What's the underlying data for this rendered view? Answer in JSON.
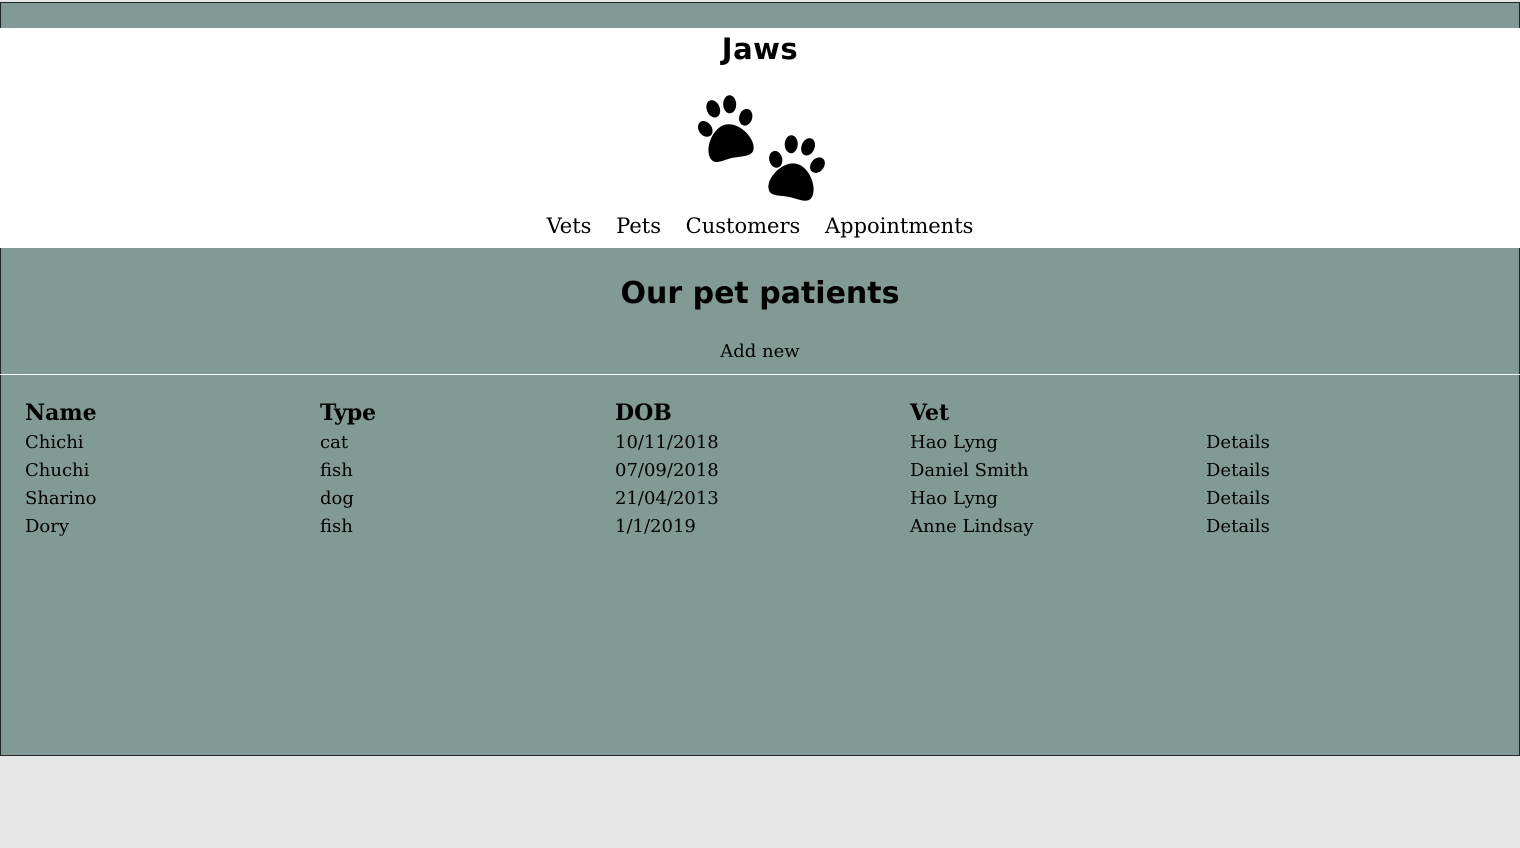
{
  "brand": {
    "title": "Jaws",
    "logo_icon": "paw-prints-icon"
  },
  "nav": {
    "items": [
      {
        "label": "Vets"
      },
      {
        "label": "Pets"
      },
      {
        "label": "Customers"
      },
      {
        "label": "Appointments"
      }
    ]
  },
  "main": {
    "title": "Our pet patients",
    "add_new_label": "Add new"
  },
  "table": {
    "headers": [
      "Name",
      "Type",
      "DOB",
      "Vet"
    ],
    "rows": [
      {
        "name": "Chichi",
        "type": "cat",
        "dob": "10/11/2018",
        "vet": "Hao Lyng",
        "action": "Details"
      },
      {
        "name": "Chuchi",
        "type": "fish",
        "dob": "07/09/2018",
        "vet": "Daniel Smith",
        "action": "Details"
      },
      {
        "name": "Sharino",
        "type": "dog",
        "dob": "21/04/2013",
        "vet": "Hao Lyng",
        "action": "Details"
      },
      {
        "name": "Dory",
        "type": "fish",
        "dob": "1/1/2019",
        "vet": "Anne Lindsay",
        "action": "Details"
      }
    ]
  },
  "colors": {
    "app_background": "#829a96",
    "header_background": "#ffffff",
    "page_background": "#e7e7e7"
  }
}
